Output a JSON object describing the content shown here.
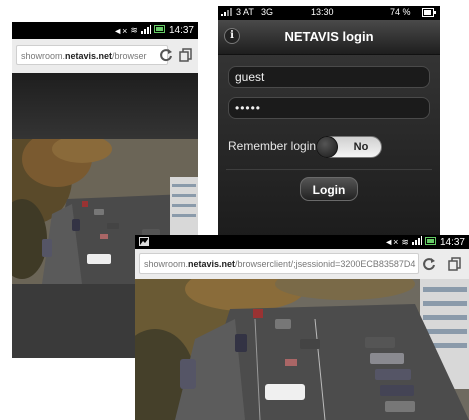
{
  "phone_left": {
    "status": {
      "time": "14:37"
    },
    "urlbar": {
      "url_prefix": "showroom.",
      "url_domain": "netavis.net",
      "url_suffix": "/browser"
    },
    "icons": [
      "refresh-icon",
      "tabs-icon"
    ]
  },
  "phone_login": {
    "status": {
      "carrier": "3 AT",
      "network": "3G",
      "time": "13:30",
      "battery": "74 %"
    },
    "nav": {
      "title": "NETAVIS login"
    },
    "form": {
      "username_value": "guest",
      "password_value": "•••••",
      "remember_label": "Remember login:",
      "remember_toggle": "No",
      "login_button": "Login"
    },
    "colors": {
      "bg": "#2a2a2a",
      "field_bg": "#1b1b1b",
      "text": "#ffffff"
    }
  },
  "phone_bottom": {
    "status": {
      "time": "14:37"
    },
    "urlbar": {
      "url_prefix": "showroom.",
      "url_domain": "netavis.net",
      "url_suffix": "/browserclient/;jsessionid=3200ECB83587D4"
    },
    "icons": [
      "refresh-icon",
      "tabs-icon"
    ]
  }
}
